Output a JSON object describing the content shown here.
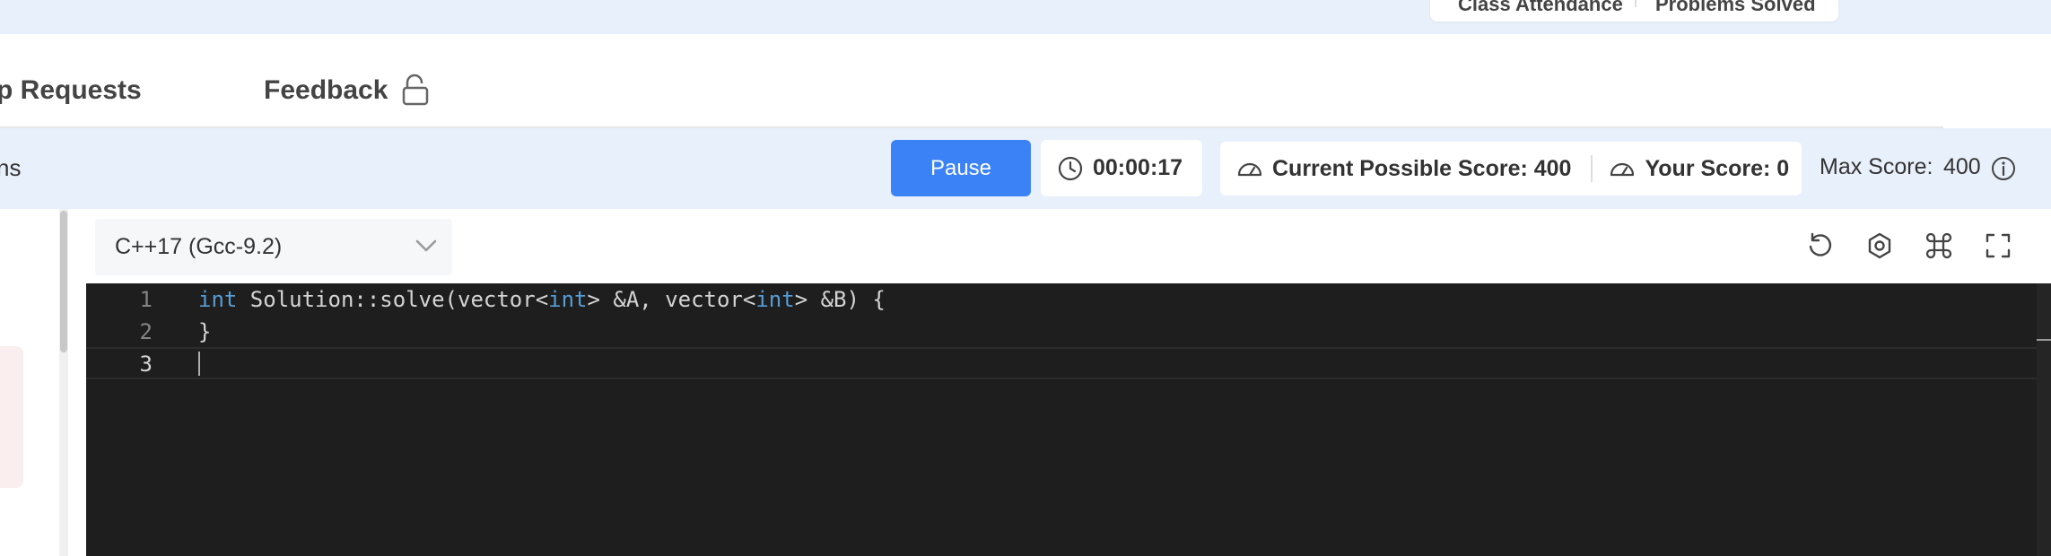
{
  "top_card": {
    "left_text": "Class Attendance",
    "right_text": "Problems Solved"
  },
  "tabs": [
    {
      "label": "Help Requests",
      "visible_label": "p Requests"
    },
    {
      "label": "Feedback",
      "locked": true
    }
  ],
  "toolbar": {
    "left_text": "ns",
    "pause_label": "Pause",
    "timer": "00:00:17",
    "current_possible_score": "Current Possible Score: 400",
    "your_score": "Your Score: 0",
    "max_score_label": "Max Score:",
    "max_score_value": "400"
  },
  "editor": {
    "language": "C++17 (Gcc-9.2)",
    "icons": [
      "reset-icon",
      "settings-icon",
      "shortcuts-icon",
      "fullscreen-icon"
    ],
    "line_numbers": [
      "1",
      "2",
      "3"
    ],
    "lines": [
      {
        "kw1": "int",
        "t1": " Solution::solve(vector<",
        "kw2": "int",
        "t2": "> &A, vector<",
        "kw3": "int",
        "t3": "> &B) {"
      },
      {
        "text": "}"
      },
      {
        "text": ""
      }
    ]
  },
  "colors": {
    "accent": "#3b82f6",
    "toolbar_bg": "#e8f1fb",
    "editor_bg": "#1e1e1e",
    "keyword": "#569cd6"
  }
}
